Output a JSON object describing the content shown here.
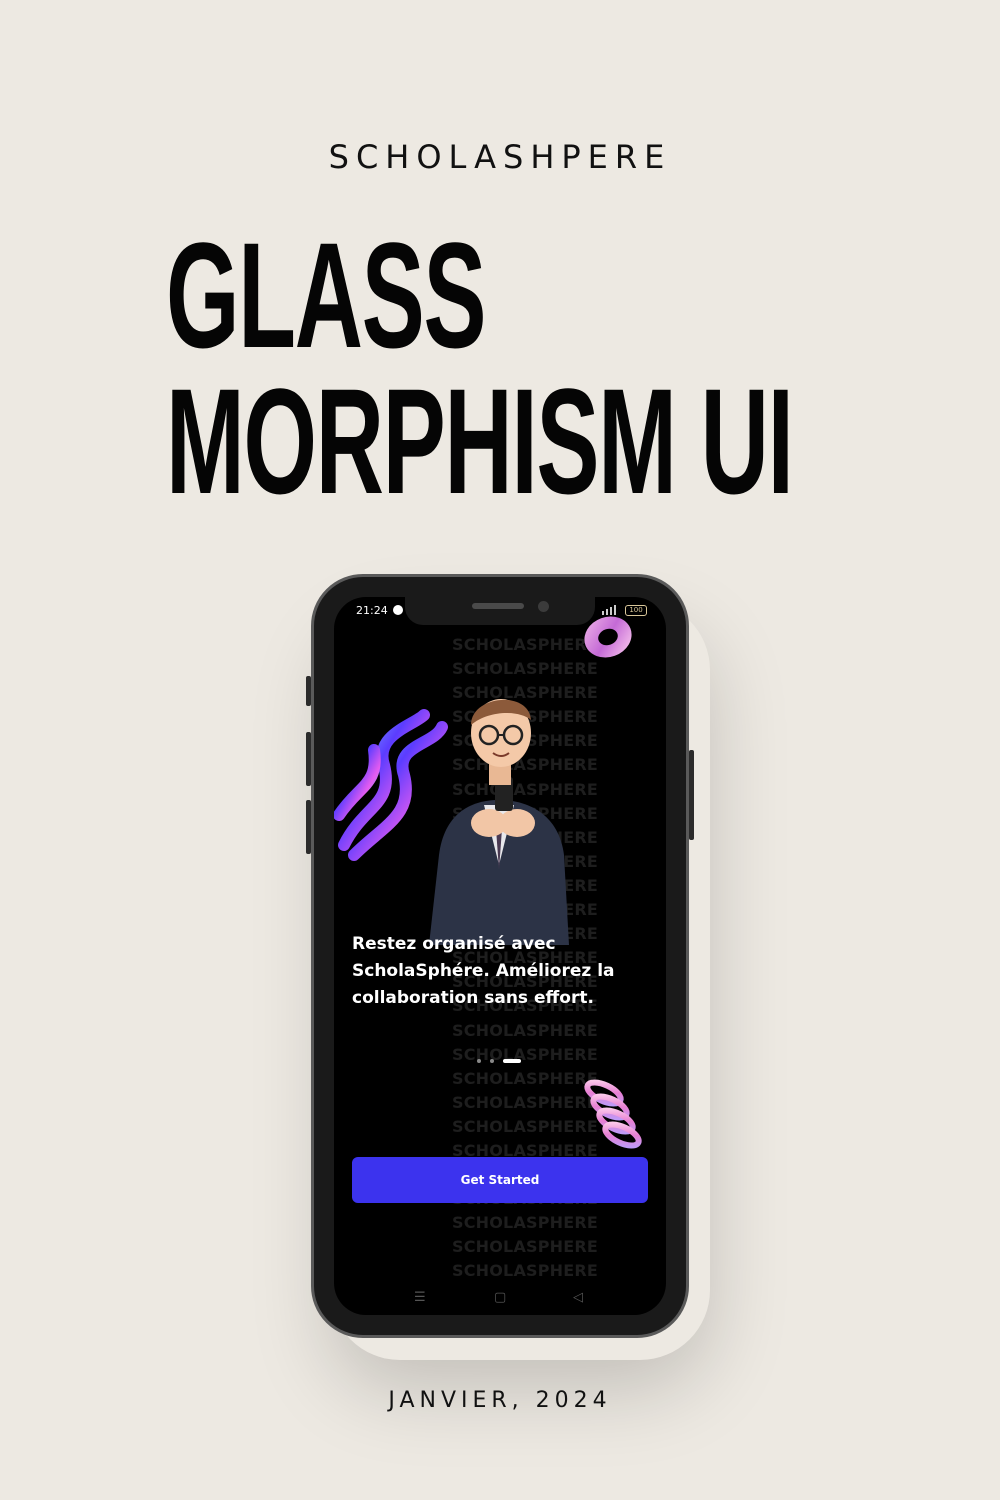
{
  "brand": "SCHOLASHPERE",
  "headline": {
    "line1": "GLASS",
    "line2": "MORPHISM UI"
  },
  "date": "JANVIER, 2024",
  "phone": {
    "status": {
      "time": "21:24",
      "battery": "100"
    },
    "watermark_text": "SCHOLASPHERE",
    "tagline": "Restez organisé avec ScholaSphére. Améliorez la collaboration sans effort.",
    "pager": {
      "pages": 3,
      "active_index": 2
    },
    "cta_label": "Get Started",
    "nav_icons": [
      "menu-icon",
      "home-square-icon",
      "back-triangle-icon"
    ]
  }
}
